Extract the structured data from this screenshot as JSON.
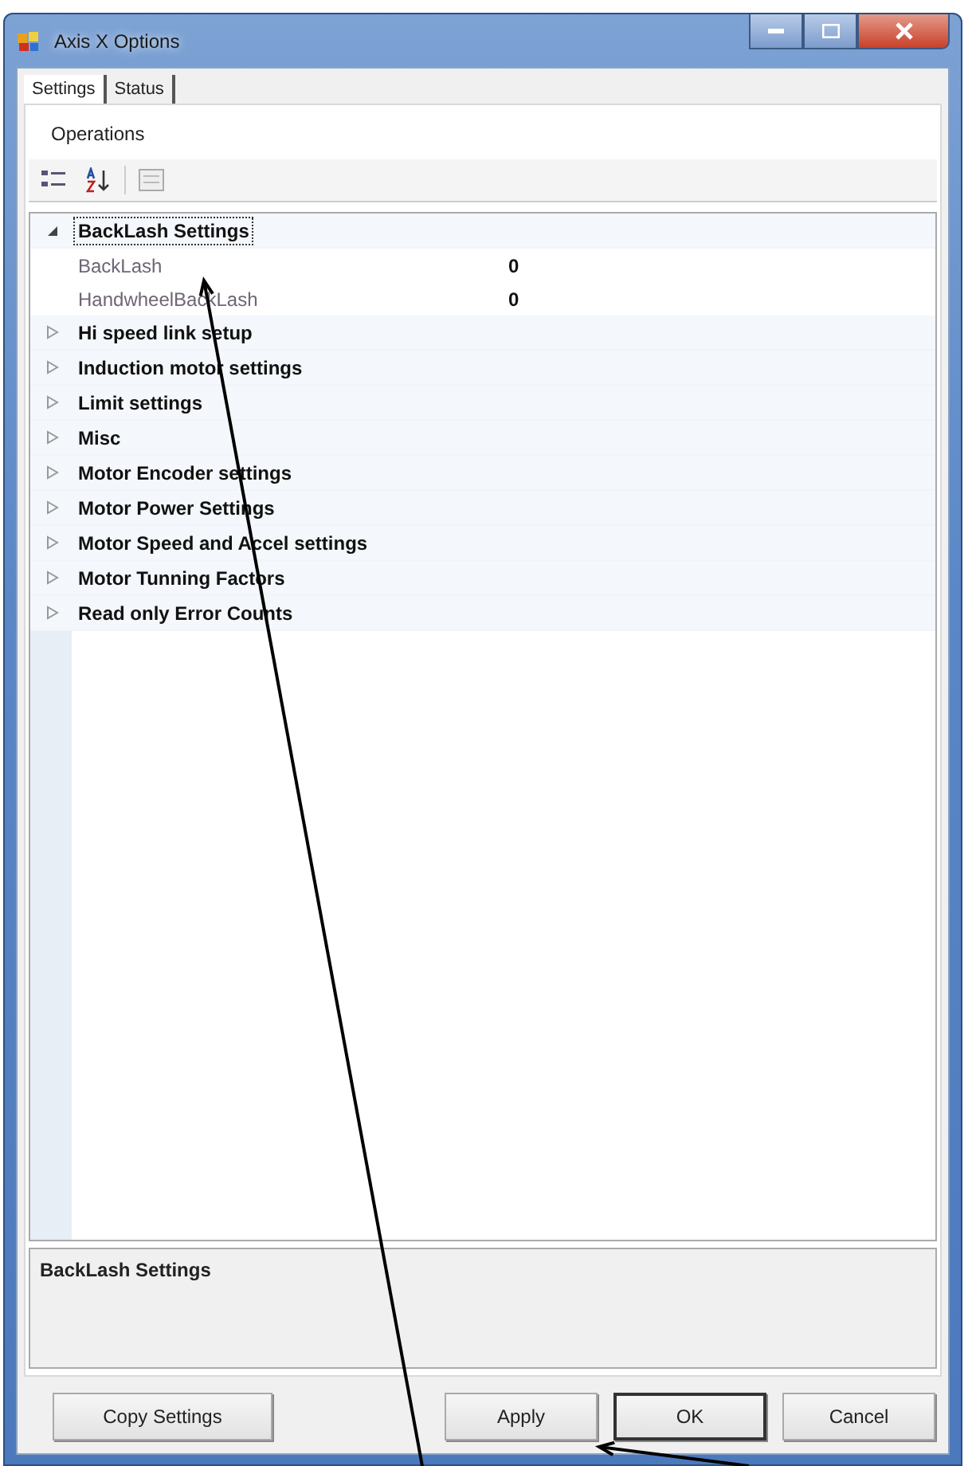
{
  "window": {
    "title": "Axis X Options"
  },
  "tabs": [
    {
      "label": "Settings",
      "selected": true
    },
    {
      "label": "Status",
      "selected": false
    }
  ],
  "section_label": "Operations",
  "property_grid": {
    "categories": [
      {
        "name": "BackLash Settings",
        "expanded": true,
        "selected": true,
        "children": [
          {
            "name": "BackLash",
            "value": "0"
          },
          {
            "name": "HandwheelBackLash",
            "value": "0"
          }
        ]
      },
      {
        "name": "Hi speed link setup",
        "expanded": false,
        "selected": false
      },
      {
        "name": "Induction motor settings",
        "expanded": false,
        "selected": false
      },
      {
        "name": "Limit settings",
        "expanded": false,
        "selected": false
      },
      {
        "name": "Misc",
        "expanded": false,
        "selected": false
      },
      {
        "name": "Motor Encoder settings",
        "expanded": false,
        "selected": false
      },
      {
        "name": "Motor Power Settings",
        "expanded": false,
        "selected": false
      },
      {
        "name": "Motor Speed and Accel settings",
        "expanded": false,
        "selected": false
      },
      {
        "name": "Motor Tunning Factors",
        "expanded": false,
        "selected": false
      },
      {
        "name": "Read only Error Counts",
        "expanded": false,
        "selected": false
      }
    ]
  },
  "description": {
    "title": "BackLash Settings"
  },
  "buttons": [
    {
      "label": "Copy Settings",
      "kind": "normal"
    },
    {
      "label": "Apply",
      "kind": "normal"
    },
    {
      "label": "OK",
      "kind": "default"
    },
    {
      "label": "Cancel",
      "kind": "normal"
    }
  ]
}
